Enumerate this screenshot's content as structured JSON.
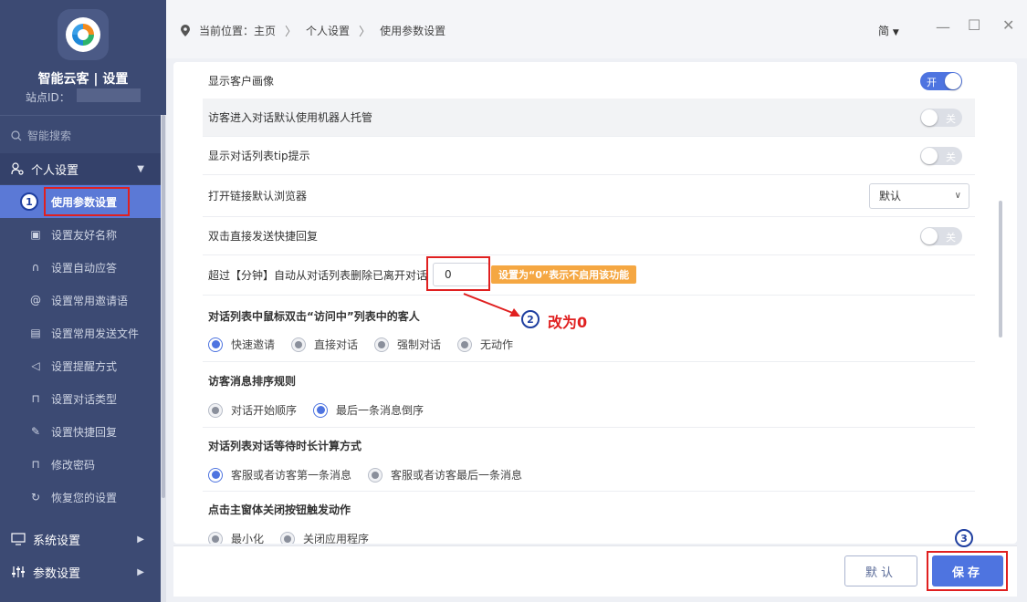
{
  "sidebar": {
    "app_title": "智能云客 | 设置",
    "station_label": "站点ID：",
    "search_label": "智能搜索",
    "group_personal": "个人设置",
    "items": [
      {
        "label": "使用参数设置",
        "icon": "settings-icon"
      },
      {
        "label": "设置友好名称",
        "icon": "nameplate-icon"
      },
      {
        "label": "设置自动应答",
        "icon": "headset-icon"
      },
      {
        "label": "设置常用邀请语",
        "icon": "at-sign-icon"
      },
      {
        "label": "设置常用发送文件",
        "icon": "file-icon"
      },
      {
        "label": "设置提醒方式",
        "icon": "speaker-icon"
      },
      {
        "label": "设置对话类型",
        "icon": "lock-icon"
      },
      {
        "label": "设置快捷回复",
        "icon": "pen-icon"
      },
      {
        "label": "修改密码",
        "icon": "lock-icon"
      },
      {
        "label": "恢复您的设置",
        "icon": "refresh-icon"
      }
    ],
    "group_system": "系统设置",
    "group_params": "参数设置"
  },
  "header": {
    "location_label": "当前位置：主页",
    "crumb_personal": "个人设置",
    "crumb_current": "使用参数设置",
    "lang": "简"
  },
  "settings": {
    "show_avatar": {
      "label": "显示客户画像",
      "state": "开"
    },
    "robot_hosting": {
      "label": "访客进入对话默认使用机器人托管",
      "state": "关"
    },
    "show_tip": {
      "label": "显示对话列表tip提示",
      "state": "关"
    },
    "browser": {
      "label": "打开链接默认浏览器",
      "value": "默认"
    },
    "double_click_reply": {
      "label": "双击直接发送快捷回复",
      "state": "关"
    },
    "auto_remove": {
      "label": "超过【分钟】自动从对话列表删除已离开对话",
      "value": "0",
      "tip": "设置为“0”表示不启用该功能"
    }
  },
  "sections": {
    "double_click_visitor": {
      "title": "对话列表中鼠标双击“访问中”列表中的客人",
      "options": [
        "快速邀请",
        "直接对话",
        "强制对话",
        "无动作"
      ],
      "selected": 0
    },
    "sort_rule": {
      "title": "访客消息排序规则",
      "options": [
        "对话开始顺序",
        "最后一条消息倒序"
      ],
      "selected": 1
    },
    "wait_time": {
      "title": "对话列表对话等待时长计算方式",
      "options": [
        "客服或者访客第一条消息",
        "客服或者访客最后一条消息"
      ],
      "selected": 0
    },
    "close_action": {
      "title": "点击主窗体关闭按钮触发动作",
      "options": [
        "最小化",
        "关闭应用程序"
      ]
    }
  },
  "annotations": {
    "step1": "1",
    "step2": "2",
    "step3": "3",
    "change_note": "改为0"
  },
  "footer": {
    "default_label": "默认",
    "save_label": "保存"
  },
  "colors": {
    "sidebar_bg": "#3c4a73",
    "accent": "#4e74e0",
    "annotation_red": "#e02020",
    "tip_orange": "#f5a742"
  }
}
